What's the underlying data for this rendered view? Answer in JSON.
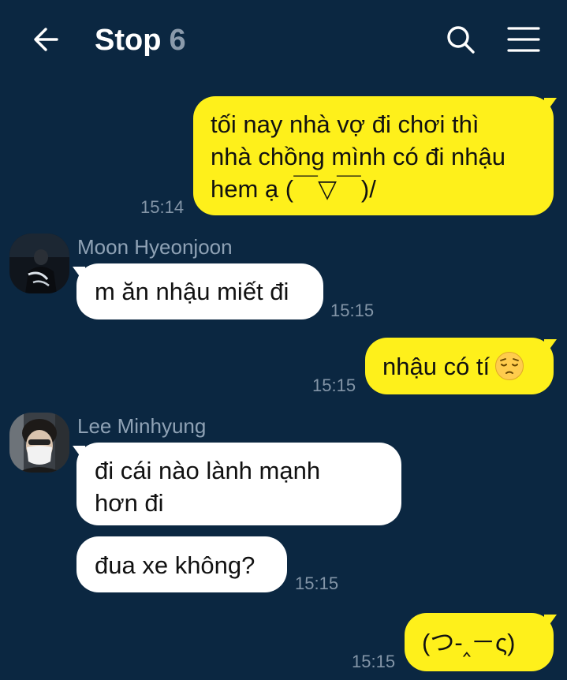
{
  "header": {
    "title": "Stop",
    "member_count": "6"
  },
  "messages": {
    "m1": {
      "text": "tối nay nhà vợ đi chơi thì\nnhà chồng mình có đi nhậu\nhem ạ (￣▽￣)/",
      "time": "15:14"
    },
    "m2": {
      "sender": "Moon Hyeonjoon",
      "text": "m ăn nhậu miết đi",
      "time": "15:15"
    },
    "m3": {
      "text": "nhậu có tí",
      "time": "15:15"
    },
    "m4": {
      "sender": "Lee Minhyung",
      "text": "đi cái nào lành mạnh\nhơn đi"
    },
    "m5": {
      "text": "đua xe không?",
      "time": "15:15"
    },
    "m6": {
      "text": "(つ-‸－ς)",
      "time": "15:15"
    }
  },
  "colors": {
    "background": "#0b2741",
    "outgoing_bubble": "#fef01b",
    "incoming_bubble": "#ffffff",
    "timestamp": "#8395a7"
  },
  "icons": {
    "back": "arrow-left-icon",
    "search": "search-icon",
    "menu": "hamburger-menu-icon",
    "emoji": "pensive-face-icon"
  }
}
